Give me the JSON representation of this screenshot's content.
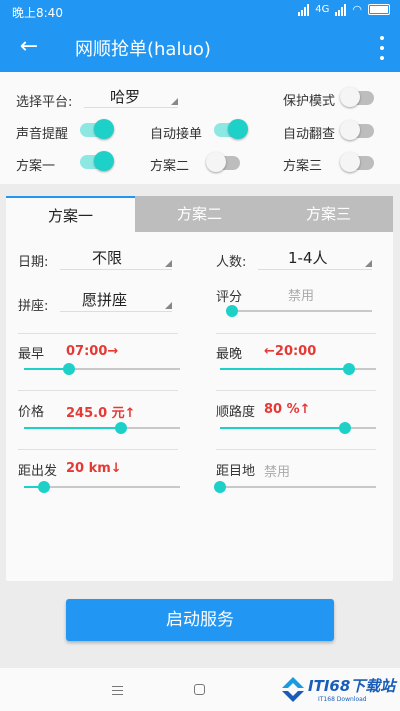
{
  "statusbar": {
    "time": "晚上8:40",
    "network": "4G",
    "battery_icon": "battery-charging-icon"
  },
  "toolbar": {
    "title": "网顺抢单(haluo)",
    "back_icon": "back-arrow-icon",
    "more_icon": "more-vertical-icon",
    "color": "#2196f3"
  },
  "settings": {
    "platform_label": "选择平台:",
    "platform_value": "哈罗",
    "protect_label": "保护模式",
    "sound_label": "声音提醒",
    "auto_accept_label": "自动接单",
    "auto_flip_label": "自动翻查",
    "plan1_label": "方案一",
    "plan2_label": "方案二",
    "plan3_label": "方案三",
    "toggles": {
      "protect": false,
      "sound": true,
      "auto_accept": true,
      "auto_flip": false,
      "plan1": true,
      "plan2": false,
      "plan3": false
    }
  },
  "tabs": [
    "方案一",
    "方案二",
    "方案三"
  ],
  "active_tab": "方案一",
  "form": {
    "date_label": "日期:",
    "date_value": "不限",
    "people_label": "人数:",
    "people_value": "1-4人",
    "carpool_label": "拼座:",
    "carpool_value": "愿拼座",
    "rating_label": "评分",
    "rating_value": "禁用",
    "earliest_label": "最早",
    "earliest_value": "07:00→",
    "latest_label": "最晚",
    "latest_value": "←20:00",
    "price_label": "价格",
    "price_value": "245.0 元↑",
    "route_label": "顺路度",
    "route_value": "80 %↑",
    "depart_label": "距出发",
    "depart_value": "20 km↓",
    "dest_label": "距目地",
    "dest_value": "禁用"
  },
  "sliders": {
    "rating": 0.0,
    "earliest": 0.29,
    "latest": 0.83,
    "price": 0.62,
    "route": 0.8,
    "depart": 0.13,
    "dest": 0.0
  },
  "start_button": "启动服务",
  "accent_color": "#1dd1c8",
  "value_color": "#e53935",
  "watermark": {
    "text": "ITI68下载站",
    "sub": "IT168 Download"
  }
}
